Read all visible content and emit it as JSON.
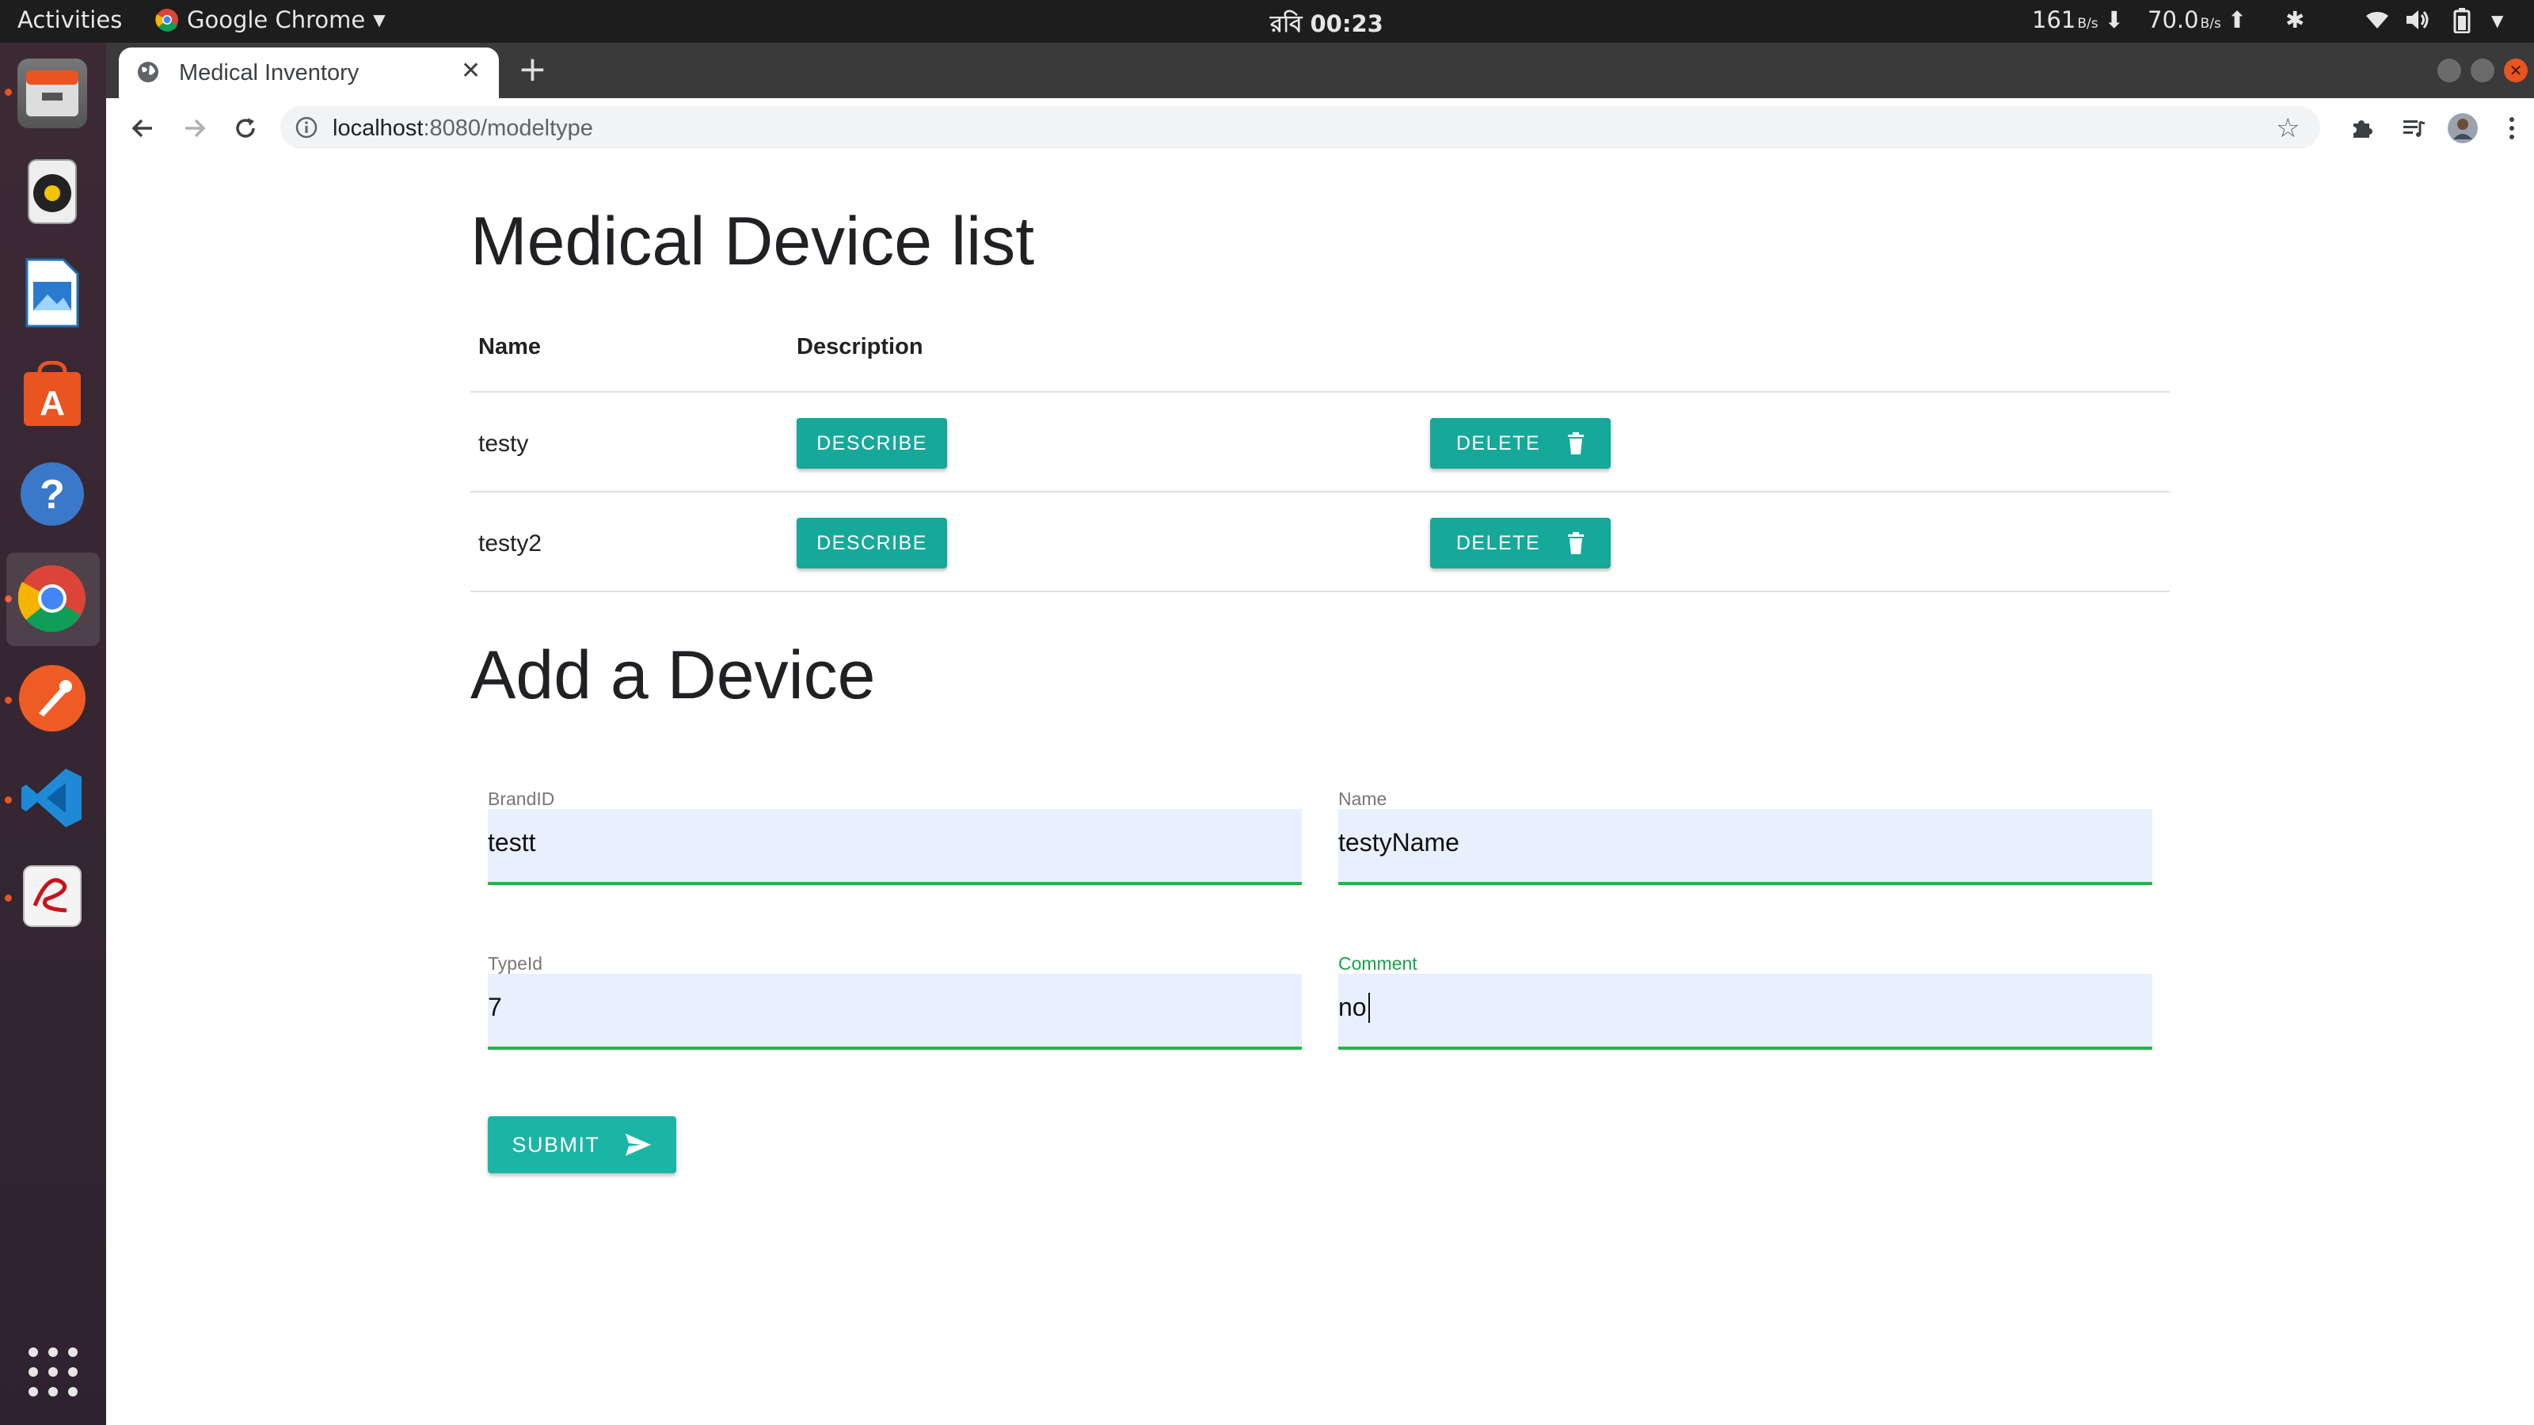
{
  "topbar": {
    "activities": "Activities",
    "app_name": "Google Chrome",
    "clock": "রবি 00:23",
    "net_down": "161",
    "net_down_unit": "B/s",
    "net_up": "70.0",
    "net_up_unit": "B/s"
  },
  "browser": {
    "tab_title": "Medical Inventory",
    "url_host": "localhost",
    "url_rest": ":8080/modeltype"
  },
  "page": {
    "list_title": "Medical Device list",
    "columns": [
      "Name",
      "Description"
    ],
    "rows": [
      {
        "name": "testy",
        "describe_label": "DESCRIBE",
        "delete_label": "DELETE"
      },
      {
        "name": "testy2",
        "describe_label": "DESCRIBE",
        "delete_label": "DELETE"
      }
    ],
    "form_title": "Add a Device",
    "form": {
      "brand_label": "BrandID",
      "brand_value": "testt",
      "name_label": "Name",
      "name_value": "testyName",
      "type_label": "TypeId",
      "type_value": "7",
      "comment_label": "Comment",
      "comment_value": "no",
      "submit_label": "SUBMIT"
    }
  },
  "colors": {
    "accent": "#16a99a",
    "field_bg": "#e8f0fe",
    "field_underline": "#23b54a",
    "comment_label_active": "#1aa34a"
  }
}
